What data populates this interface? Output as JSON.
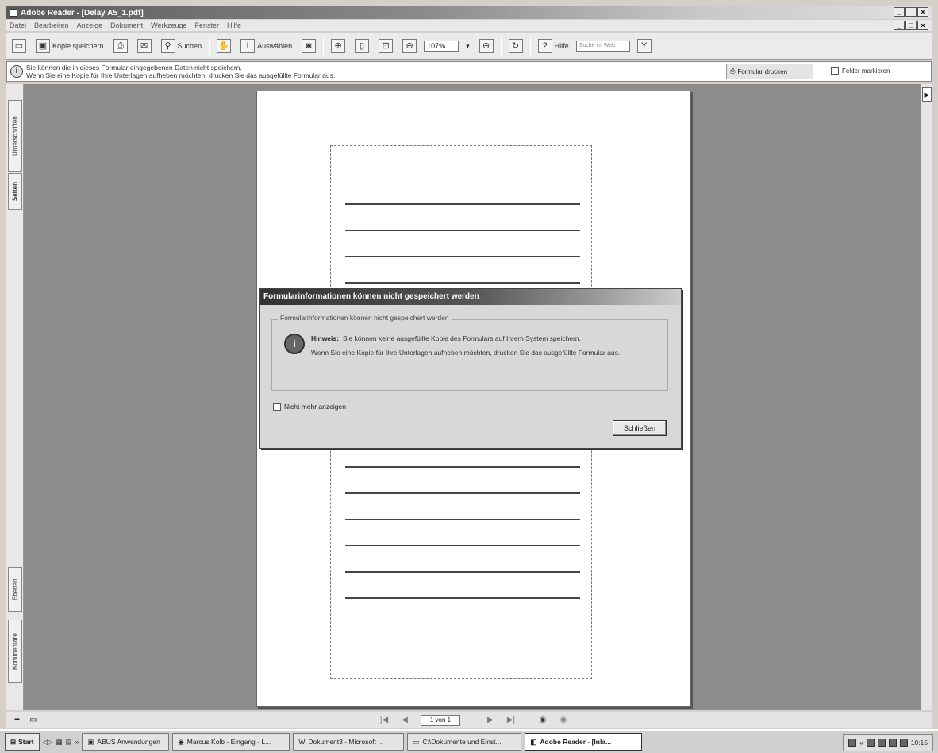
{
  "window": {
    "title": "Adobe Reader - [Delay A5_1.pdf]",
    "min": "_",
    "max": "□",
    "close": "×"
  },
  "menu": [
    "Datei",
    "Bearbeiten",
    "Anzeige",
    "Dokument",
    "Werkzeuge",
    "Fenster",
    "Hilfe"
  ],
  "toolbar": {
    "save_copy": "Kopie speichern",
    "search": "Suchen",
    "select": "Auswählen",
    "zoom": "107%",
    "help": "Hilfe",
    "search_web_placeholder": "Suche im Web"
  },
  "docbar": {
    "line1": "Sie können die in dieses Formular eingegebenen Daten nicht speichern.",
    "line2": "Wenn Sie eine Kopie für Ihre Unterlagen aufheben möchten, drucken Sie das ausgefüllte Formular aus.",
    "print_form": "Formular drucken",
    "highlight_fields": "Felder markieren"
  },
  "left_tabs": [
    "Unterschriften",
    "Seiten",
    "Ebenen",
    "Kommentare"
  ],
  "dialog": {
    "title": "Formularinformationen können nicht gespeichert werden",
    "group_label": "Formularinformationen können nicht gespeichert werden",
    "note_label": "Hinweis:",
    "note_text": "Sie können keine ausgefüllte Kopie des Formulars auf Ihrem System speichern.",
    "note_text2": "Wenn Sie eine Kopie für Ihre Unterlagen aufheben möchten, drucken Sie das ausgefüllte Formular aus.",
    "dont_show": "Nicht mehr anzeigen",
    "close_button": "Schließen"
  },
  "statusbar": {
    "page_indicator": "1 von 1"
  },
  "taskbar": {
    "start": "Start",
    "tasks": [
      {
        "label": "ABUS Anwendungen",
        "active": false
      },
      {
        "label": "Marcus Kolb - Eingang - L...",
        "active": false
      },
      {
        "label": "Dokument3 - Microsoft ...",
        "active": false
      },
      {
        "label": "C:\\Dokumente und Einst...",
        "active": false
      },
      {
        "label": "Adobe Reader - [Inla...",
        "active": true
      }
    ],
    "clock": "10:15"
  }
}
